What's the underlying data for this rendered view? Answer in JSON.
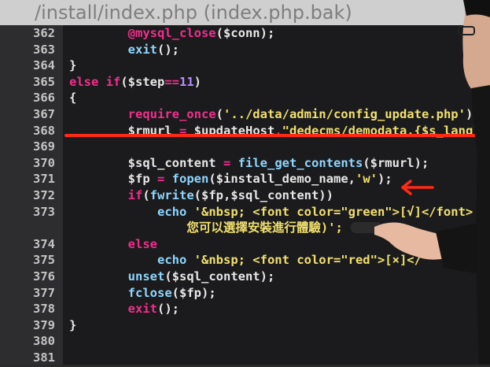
{
  "header": {
    "title": "/install/index.php (index.php.bak)"
  },
  "lines": [
    {
      "no": "362",
      "tokens": [
        {
          "t": "        ",
          "c": "var"
        },
        {
          "t": "@mysql_close",
          "c": "at"
        },
        {
          "t": "($conn);",
          "c": "var"
        }
      ]
    },
    {
      "no": "363",
      "tokens": [
        {
          "t": "        ",
          "c": "var"
        },
        {
          "t": "exit",
          "c": "fn"
        },
        {
          "t": "();",
          "c": "var"
        }
      ]
    },
    {
      "no": "364",
      "tokens": [
        {
          "t": "}",
          "c": "var"
        }
      ]
    },
    {
      "no": "365",
      "tokens": [
        {
          "t": "else if",
          "c": "kw"
        },
        {
          "t": "($step",
          "c": "var"
        },
        {
          "t": "==",
          "c": "op"
        },
        {
          "t": "11",
          "c": "num"
        },
        {
          "t": ")",
          "c": "var"
        }
      ]
    },
    {
      "no": "366",
      "tokens": [
        {
          "t": "{",
          "c": "var"
        }
      ]
    },
    {
      "no": "367",
      "tokens": [
        {
          "t": "        ",
          "c": "var"
        },
        {
          "t": "require_once",
          "c": "kw"
        },
        {
          "t": "(",
          "c": "var"
        },
        {
          "t": "'../data/admin/config_update.php'",
          "c": "str"
        },
        {
          "t": ");",
          "c": "var"
        }
      ]
    },
    {
      "no": "368",
      "tokens": [
        {
          "t": "        ",
          "c": "var"
        },
        {
          "t": "$rmurl ",
          "c": "var"
        },
        {
          "t": "=",
          "c": "op"
        },
        {
          "t": " $updateHost",
          "c": "var"
        },
        {
          "t": ".",
          "c": "op"
        },
        {
          "t": "\"dedecms/demodata.{$s_lang}",
          "c": "str"
        }
      ]
    },
    {
      "no": "369",
      "tokens": []
    },
    {
      "no": "370",
      "tokens": [
        {
          "t": "        ",
          "c": "var"
        },
        {
          "t": "$sql_content ",
          "c": "var"
        },
        {
          "t": "=",
          "c": "op"
        },
        {
          "t": " ",
          "c": "var"
        },
        {
          "t": "file_get_contents",
          "c": "fn"
        },
        {
          "t": "($rmurl);",
          "c": "var"
        }
      ]
    },
    {
      "no": "371",
      "tokens": [
        {
          "t": "        ",
          "c": "var"
        },
        {
          "t": "$fp ",
          "c": "var"
        },
        {
          "t": "=",
          "c": "op"
        },
        {
          "t": " ",
          "c": "var"
        },
        {
          "t": "fopen",
          "c": "fn"
        },
        {
          "t": "($install_demo_name,",
          "c": "var"
        },
        {
          "t": "'w'",
          "c": "str"
        },
        {
          "t": ");",
          "c": "var"
        }
      ]
    },
    {
      "no": "372",
      "tokens": [
        {
          "t": "        ",
          "c": "var"
        },
        {
          "t": "if",
          "c": "kw"
        },
        {
          "t": "(",
          "c": "var"
        },
        {
          "t": "fwrite",
          "c": "fn"
        },
        {
          "t": "($fp,$sql_content))",
          "c": "var"
        }
      ]
    },
    {
      "no": "373",
      "tokens": [
        {
          "t": "            ",
          "c": "var"
        },
        {
          "t": "echo",
          "c": "fn"
        },
        {
          "t": " ",
          "c": "var"
        },
        {
          "t": "'&nbsp; <font color=\"green\">[√]</font>",
          "c": "str"
        }
      ]
    },
    {
      "no": "",
      "tokens": [
        {
          "t": "                ",
          "c": "var"
        },
        {
          "t": "您可以選擇安裝進行體驗)';",
          "c": "str"
        }
      ]
    },
    {
      "no": "374",
      "tokens": [
        {
          "t": "        ",
          "c": "var"
        },
        {
          "t": "else",
          "c": "kw"
        }
      ]
    },
    {
      "no": "375",
      "tokens": [
        {
          "t": "            ",
          "c": "var"
        },
        {
          "t": "echo",
          "c": "fn"
        },
        {
          "t": " ",
          "c": "var"
        },
        {
          "t": "'&nbsp; <font color=\"red\">[×]</",
          "c": "str"
        }
      ]
    },
    {
      "no": "376",
      "tokens": [
        {
          "t": "        ",
          "c": "var"
        },
        {
          "t": "unset",
          "c": "fn"
        },
        {
          "t": "($sql_content);",
          "c": "var"
        }
      ]
    },
    {
      "no": "377",
      "tokens": [
        {
          "t": "        ",
          "c": "var"
        },
        {
          "t": "fclose",
          "c": "fn"
        },
        {
          "t": "($fp);",
          "c": "var"
        }
      ]
    },
    {
      "no": "378",
      "tokens": [
        {
          "t": "        ",
          "c": "var"
        },
        {
          "t": "exit",
          "c": "kw"
        },
        {
          "t": "();",
          "c": "var"
        }
      ]
    },
    {
      "no": "379",
      "tokens": [
        {
          "t": "}",
          "c": "var"
        }
      ]
    },
    {
      "no": "380",
      "tokens": []
    },
    {
      "no": "381",
      "tokens": []
    }
  ],
  "colors": {
    "background": "#1b1b1d",
    "gutter": "#2d2d30",
    "keyword": "#f12f8c",
    "function": "#8fd6ff",
    "string": "#f1e06e",
    "number": "#b38cff",
    "annotation": "#ff2a12"
  }
}
